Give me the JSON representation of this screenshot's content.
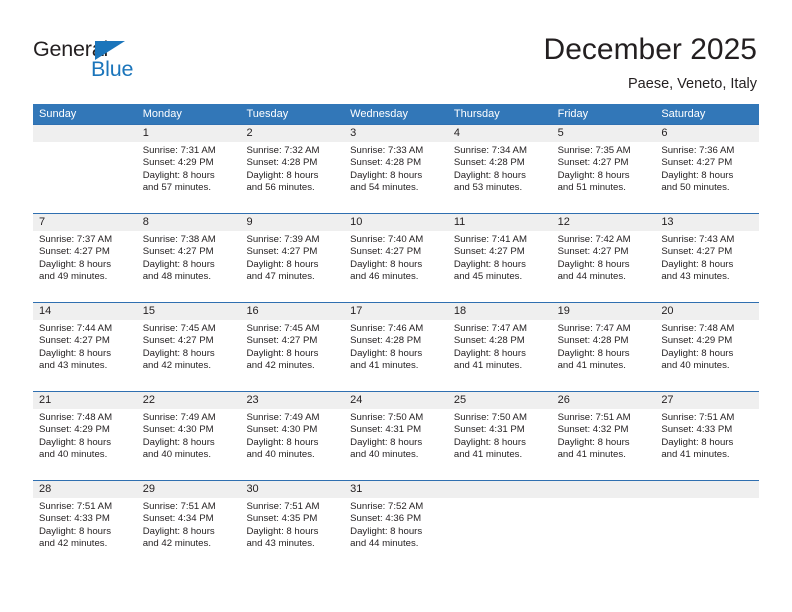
{
  "brand": {
    "line1": "General",
    "line2": "Blue",
    "triangle_icon": "blue-triangle-icon",
    "color_dark": "#231f20",
    "color_blue": "#1b75bb"
  },
  "header": {
    "title": "December 2025",
    "subtitle": "Paese, Veneto, Italy"
  },
  "theme": {
    "header_blue": "#3277b8",
    "rule_blue": "#2f6fb0",
    "daynum_gray": "#efefef",
    "text": "#231f20"
  },
  "weekdays": [
    "Sunday",
    "Monday",
    "Tuesday",
    "Wednesday",
    "Thursday",
    "Friday",
    "Saturday"
  ],
  "weeks": [
    [
      {
        "day": "",
        "sunrise": "",
        "sunset": "",
        "daylight1": "",
        "daylight2": ""
      },
      {
        "day": "1",
        "sunrise": "Sunrise: 7:31 AM",
        "sunset": "Sunset: 4:29 PM",
        "daylight1": "Daylight: 8 hours",
        "daylight2": "and 57 minutes."
      },
      {
        "day": "2",
        "sunrise": "Sunrise: 7:32 AM",
        "sunset": "Sunset: 4:28 PM",
        "daylight1": "Daylight: 8 hours",
        "daylight2": "and 56 minutes."
      },
      {
        "day": "3",
        "sunrise": "Sunrise: 7:33 AM",
        "sunset": "Sunset: 4:28 PM",
        "daylight1": "Daylight: 8 hours",
        "daylight2": "and 54 minutes."
      },
      {
        "day": "4",
        "sunrise": "Sunrise: 7:34 AM",
        "sunset": "Sunset: 4:28 PM",
        "daylight1": "Daylight: 8 hours",
        "daylight2": "and 53 minutes."
      },
      {
        "day": "5",
        "sunrise": "Sunrise: 7:35 AM",
        "sunset": "Sunset: 4:27 PM",
        "daylight1": "Daylight: 8 hours",
        "daylight2": "and 51 minutes."
      },
      {
        "day": "6",
        "sunrise": "Sunrise: 7:36 AM",
        "sunset": "Sunset: 4:27 PM",
        "daylight1": "Daylight: 8 hours",
        "daylight2": "and 50 minutes."
      }
    ],
    [
      {
        "day": "7",
        "sunrise": "Sunrise: 7:37 AM",
        "sunset": "Sunset: 4:27 PM",
        "daylight1": "Daylight: 8 hours",
        "daylight2": "and 49 minutes."
      },
      {
        "day": "8",
        "sunrise": "Sunrise: 7:38 AM",
        "sunset": "Sunset: 4:27 PM",
        "daylight1": "Daylight: 8 hours",
        "daylight2": "and 48 minutes."
      },
      {
        "day": "9",
        "sunrise": "Sunrise: 7:39 AM",
        "sunset": "Sunset: 4:27 PM",
        "daylight1": "Daylight: 8 hours",
        "daylight2": "and 47 minutes."
      },
      {
        "day": "10",
        "sunrise": "Sunrise: 7:40 AM",
        "sunset": "Sunset: 4:27 PM",
        "daylight1": "Daylight: 8 hours",
        "daylight2": "and 46 minutes."
      },
      {
        "day": "11",
        "sunrise": "Sunrise: 7:41 AM",
        "sunset": "Sunset: 4:27 PM",
        "daylight1": "Daylight: 8 hours",
        "daylight2": "and 45 minutes."
      },
      {
        "day": "12",
        "sunrise": "Sunrise: 7:42 AM",
        "sunset": "Sunset: 4:27 PM",
        "daylight1": "Daylight: 8 hours",
        "daylight2": "and 44 minutes."
      },
      {
        "day": "13",
        "sunrise": "Sunrise: 7:43 AM",
        "sunset": "Sunset: 4:27 PM",
        "daylight1": "Daylight: 8 hours",
        "daylight2": "and 43 minutes."
      }
    ],
    [
      {
        "day": "14",
        "sunrise": "Sunrise: 7:44 AM",
        "sunset": "Sunset: 4:27 PM",
        "daylight1": "Daylight: 8 hours",
        "daylight2": "and 43 minutes."
      },
      {
        "day": "15",
        "sunrise": "Sunrise: 7:45 AM",
        "sunset": "Sunset: 4:27 PM",
        "daylight1": "Daylight: 8 hours",
        "daylight2": "and 42 minutes."
      },
      {
        "day": "16",
        "sunrise": "Sunrise: 7:45 AM",
        "sunset": "Sunset: 4:27 PM",
        "daylight1": "Daylight: 8 hours",
        "daylight2": "and 42 minutes."
      },
      {
        "day": "17",
        "sunrise": "Sunrise: 7:46 AM",
        "sunset": "Sunset: 4:28 PM",
        "daylight1": "Daylight: 8 hours",
        "daylight2": "and 41 minutes."
      },
      {
        "day": "18",
        "sunrise": "Sunrise: 7:47 AM",
        "sunset": "Sunset: 4:28 PM",
        "daylight1": "Daylight: 8 hours",
        "daylight2": "and 41 minutes."
      },
      {
        "day": "19",
        "sunrise": "Sunrise: 7:47 AM",
        "sunset": "Sunset: 4:28 PM",
        "daylight1": "Daylight: 8 hours",
        "daylight2": "and 41 minutes."
      },
      {
        "day": "20",
        "sunrise": "Sunrise: 7:48 AM",
        "sunset": "Sunset: 4:29 PM",
        "daylight1": "Daylight: 8 hours",
        "daylight2": "and 40 minutes."
      }
    ],
    [
      {
        "day": "21",
        "sunrise": "Sunrise: 7:48 AM",
        "sunset": "Sunset: 4:29 PM",
        "daylight1": "Daylight: 8 hours",
        "daylight2": "and 40 minutes."
      },
      {
        "day": "22",
        "sunrise": "Sunrise: 7:49 AM",
        "sunset": "Sunset: 4:30 PM",
        "daylight1": "Daylight: 8 hours",
        "daylight2": "and 40 minutes."
      },
      {
        "day": "23",
        "sunrise": "Sunrise: 7:49 AM",
        "sunset": "Sunset: 4:30 PM",
        "daylight1": "Daylight: 8 hours",
        "daylight2": "and 40 minutes."
      },
      {
        "day": "24",
        "sunrise": "Sunrise: 7:50 AM",
        "sunset": "Sunset: 4:31 PM",
        "daylight1": "Daylight: 8 hours",
        "daylight2": "and 40 minutes."
      },
      {
        "day": "25",
        "sunrise": "Sunrise: 7:50 AM",
        "sunset": "Sunset: 4:31 PM",
        "daylight1": "Daylight: 8 hours",
        "daylight2": "and 41 minutes."
      },
      {
        "day": "26",
        "sunrise": "Sunrise: 7:51 AM",
        "sunset": "Sunset: 4:32 PM",
        "daylight1": "Daylight: 8 hours",
        "daylight2": "and 41 minutes."
      },
      {
        "day": "27",
        "sunrise": "Sunrise: 7:51 AM",
        "sunset": "Sunset: 4:33 PM",
        "daylight1": "Daylight: 8 hours",
        "daylight2": "and 41 minutes."
      }
    ],
    [
      {
        "day": "28",
        "sunrise": "Sunrise: 7:51 AM",
        "sunset": "Sunset: 4:33 PM",
        "daylight1": "Daylight: 8 hours",
        "daylight2": "and 42 minutes."
      },
      {
        "day": "29",
        "sunrise": "Sunrise: 7:51 AM",
        "sunset": "Sunset: 4:34 PM",
        "daylight1": "Daylight: 8 hours",
        "daylight2": "and 42 minutes."
      },
      {
        "day": "30",
        "sunrise": "Sunrise: 7:51 AM",
        "sunset": "Sunset: 4:35 PM",
        "daylight1": "Daylight: 8 hours",
        "daylight2": "and 43 minutes."
      },
      {
        "day": "31",
        "sunrise": "Sunrise: 7:52 AM",
        "sunset": "Sunset: 4:36 PM",
        "daylight1": "Daylight: 8 hours",
        "daylight2": "and 44 minutes."
      },
      {
        "day": "",
        "sunrise": "",
        "sunset": "",
        "daylight1": "",
        "daylight2": ""
      },
      {
        "day": "",
        "sunrise": "",
        "sunset": "",
        "daylight1": "",
        "daylight2": ""
      },
      {
        "day": "",
        "sunrise": "",
        "sunset": "",
        "daylight1": "",
        "daylight2": ""
      }
    ]
  ]
}
